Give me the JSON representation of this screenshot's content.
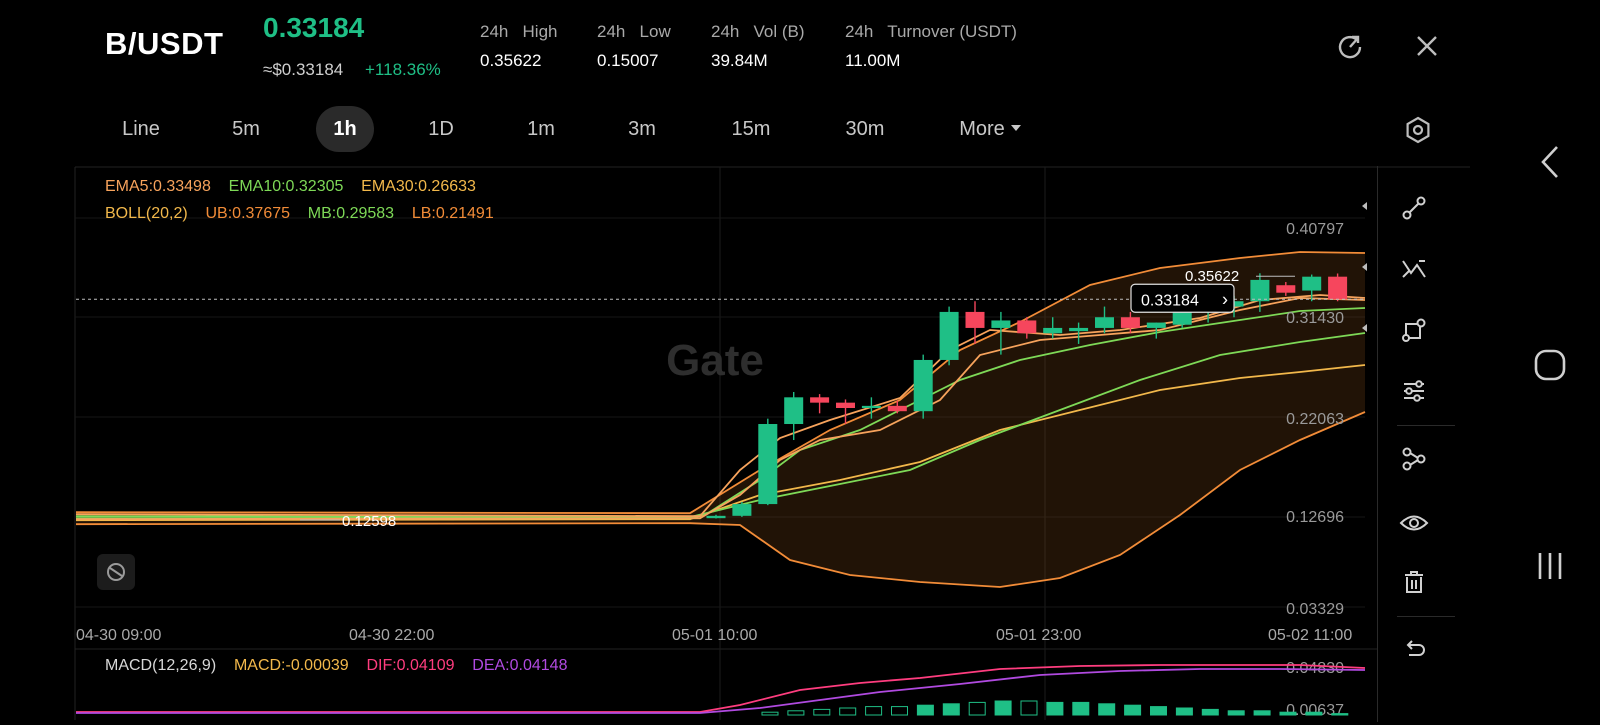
{
  "header": {
    "pair": "B/USDT",
    "price": "0.33184",
    "usd_price": "≈$0.33184",
    "change": "+118.36%",
    "stats": [
      {
        "label": "24h   High",
        "value": "0.35622"
      },
      {
        "label": "24h   Low",
        "value": "0.15007"
      },
      {
        "label": "24h   Vol (B)",
        "value": "39.84M"
      },
      {
        "label": "24h   Turnover (USDT)",
        "value": "11.00M"
      }
    ],
    "icons": {
      "share": "share-icon",
      "close": "close-icon"
    }
  },
  "tabs": [
    "Line",
    "5m",
    "1h",
    "1D",
    "1m",
    "3m",
    "15m",
    "30m",
    "More"
  ],
  "active_tab": "1h",
  "indicators": {
    "ema5": "EMA5:0.33498",
    "ema10": "EMA10:0.32305",
    "ema30": "EMA30:0.26633",
    "boll": "BOLL(20,2)",
    "ub": "UB:0.37675",
    "mb": "MB:0.29583",
    "lb": "LB:0.21491",
    "macd": "MACD(12,26,9)",
    "macd_val": "MACD:-0.00039",
    "dif": "DIF:0.04109",
    "dea": "DEA:0.04148"
  },
  "watermark": "Gate",
  "price_axis": [
    "0.40797",
    "0.31430",
    "0.22063",
    "0.12696",
    "0.03329"
  ],
  "macd_axis": [
    "0.04830",
    "0.00637"
  ],
  "time_axis": [
    "04-30 09:00",
    "04-30 22:00",
    "05-01 10:00",
    "05-01 23:00",
    "05-02 11:00"
  ],
  "markers": {
    "high": "0.35622",
    "current": "0.33184",
    "low": "0.12598"
  },
  "colors": {
    "up": "#1fbf86",
    "down": "#f6465d",
    "ema5": "#f7a35c",
    "ema10": "#7ed957",
    "ema30": "#f2b84b",
    "boll": "#f28c38",
    "dif": "#ff3d7f",
    "dea": "#b04ae0"
  },
  "chart_data": {
    "type": "candlestick",
    "interval": "1h",
    "y_range": [
      0.03329,
      0.40797
    ],
    "candles": [
      {
        "o": 0.1268,
        "h": 0.13,
        "l": 0.1265,
        "c": 0.129
      },
      {
        "o": 0.129,
        "h": 0.142,
        "l": 0.128,
        "c": 0.14
      },
      {
        "o": 0.14,
        "h": 0.22,
        "l": 0.139,
        "c": 0.215
      },
      {
        "o": 0.215,
        "h": 0.245,
        "l": 0.2,
        "c": 0.24
      },
      {
        "o": 0.24,
        "h": 0.243,
        "l": 0.225,
        "c": 0.235
      },
      {
        "o": 0.235,
        "h": 0.238,
        "l": 0.215,
        "c": 0.23
      },
      {
        "o": 0.23,
        "h": 0.24,
        "l": 0.22,
        "c": 0.232
      },
      {
        "o": 0.232,
        "h": 0.237,
        "l": 0.225,
        "c": 0.227
      },
      {
        "o": 0.227,
        "h": 0.28,
        "l": 0.22,
        "c": 0.275
      },
      {
        "o": 0.275,
        "h": 0.325,
        "l": 0.27,
        "c": 0.32
      },
      {
        "o": 0.32,
        "h": 0.33,
        "l": 0.29,
        "c": 0.305
      },
      {
        "o": 0.305,
        "h": 0.32,
        "l": 0.28,
        "c": 0.312
      },
      {
        "o": 0.312,
        "h": 0.315,
        "l": 0.295,
        "c": 0.3
      },
      {
        "o": 0.3,
        "h": 0.315,
        "l": 0.295,
        "c": 0.305
      },
      {
        "o": 0.302,
        "h": 0.31,
        "l": 0.29,
        "c": 0.305
      },
      {
        "o": 0.305,
        "h": 0.325,
        "l": 0.3,
        "c": 0.315
      },
      {
        "o": 0.315,
        "h": 0.32,
        "l": 0.3,
        "c": 0.305
      },
      {
        "o": 0.305,
        "h": 0.31,
        "l": 0.295,
        "c": 0.31
      },
      {
        "o": 0.308,
        "h": 0.325,
        "l": 0.305,
        "c": 0.32
      },
      {
        "o": 0.32,
        "h": 0.33,
        "l": 0.31,
        "c": 0.325
      },
      {
        "o": 0.325,
        "h": 0.335,
        "l": 0.315,
        "c": 0.33
      },
      {
        "o": 0.33,
        "h": 0.3562,
        "l": 0.32,
        "c": 0.35
      },
      {
        "o": 0.345,
        "h": 0.348,
        "l": 0.335,
        "c": 0.338
      },
      {
        "o": 0.34,
        "h": 0.355,
        "l": 0.33,
        "c": 0.353
      },
      {
        "o": 0.353,
        "h": 0.356,
        "l": 0.33,
        "c": 0.3318
      }
    ]
  }
}
